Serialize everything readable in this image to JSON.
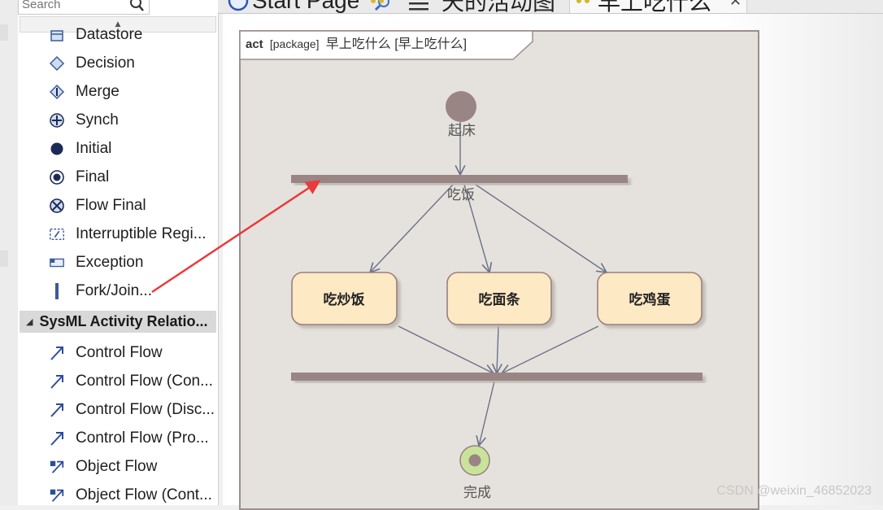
{
  "search": {
    "placeholder": "Search"
  },
  "toolbox": {
    "items": [
      {
        "label": "Datastore",
        "icon": "datastore-icon"
      },
      {
        "label": "Decision",
        "icon": "decision-icon"
      },
      {
        "label": "Merge",
        "icon": "merge-icon"
      },
      {
        "label": "Synch",
        "icon": "synch-icon"
      },
      {
        "label": "Initial",
        "icon": "initial-icon"
      },
      {
        "label": "Final",
        "icon": "final-icon"
      },
      {
        "label": "Flow Final",
        "icon": "flow-final-icon"
      },
      {
        "label": "Interruptible Regi...",
        "icon": "interruptible-region-icon"
      },
      {
        "label": "Exception",
        "icon": "exception-icon"
      },
      {
        "label": "Fork/Join...",
        "icon": "fork-join-icon"
      }
    ],
    "section_label": "SysML Activity Relatio...",
    "relations": [
      {
        "label": "Control Flow",
        "icon": "control-flow-icon"
      },
      {
        "label": "Control Flow (Con...",
        "icon": "control-flow-icon"
      },
      {
        "label": "Control Flow (Disc...",
        "icon": "control-flow-icon"
      },
      {
        "label": "Control Flow (Pro...",
        "icon": "control-flow-icon"
      },
      {
        "label": "Object Flow",
        "icon": "object-flow-icon"
      },
      {
        "label": "Object Flow (Cont...",
        "icon": "object-flow-icon"
      }
    ]
  },
  "tabs": [
    {
      "label": "Start Page"
    },
    {
      "label": "天的活动图"
    },
    {
      "label": "早上吃什么"
    }
  ],
  "diagram": {
    "frame_kind": "act",
    "frame_stereotype": "[package]",
    "frame_name": "早上吃什么 [早上吃什么]",
    "initial_label": "起床",
    "fork_label": "吃饭",
    "actions": [
      "吃炒饭",
      "吃面条",
      "吃鸡蛋"
    ],
    "final_label": "完成",
    "colors": {
      "bar": "#9a8585",
      "action_fill": "#fde9c4",
      "action_border": "#9b7e7e",
      "initial": "#9a8585",
      "final": "#c9e39b",
      "annotation": "#ea3a3a",
      "flow": "#6c7286"
    }
  },
  "watermark": "CSDN @weixin_46852023"
}
